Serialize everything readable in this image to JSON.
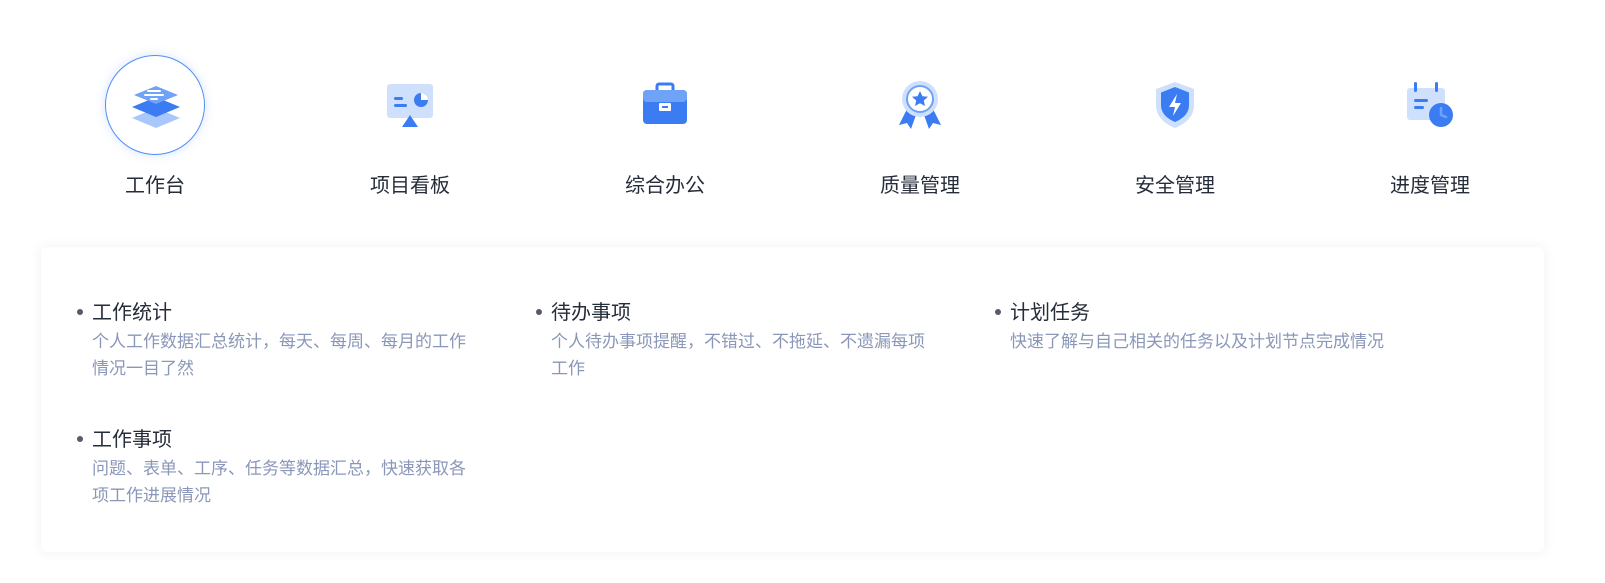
{
  "modules": [
    {
      "label": "工作台",
      "icon": "layers-icon",
      "active": true
    },
    {
      "label": "项目看板",
      "icon": "dashboard-board-icon",
      "active": false
    },
    {
      "label": "综合办公",
      "icon": "briefcase-icon",
      "active": false
    },
    {
      "label": "质量管理",
      "icon": "award-medal-icon",
      "active": false
    },
    {
      "label": "安全管理",
      "icon": "shield-bolt-icon",
      "active": false
    },
    {
      "label": "进度管理",
      "icon": "calendar-clock-icon",
      "active": false
    }
  ],
  "features": [
    {
      "title": "工作统计",
      "desc": "个人工作数据汇总统计，每天、每周、每月的工作情况一目了然"
    },
    {
      "title": "待办事项",
      "desc": "个人待办事项提醒，不错过、不拖延、不遗漏每项工作"
    },
    {
      "title": "计划任务",
      "desc": "快速了解与自己相关的任务以及计划节点完成情况"
    },
    {
      "title": "工作事项",
      "desc": "问题、表单、工序、任务等数据汇总，快速获取各项工作进展情况"
    }
  ],
  "colors": {
    "accent": "#4f8ef7",
    "text": "#262d3a",
    "desc": "#8a97b8"
  }
}
